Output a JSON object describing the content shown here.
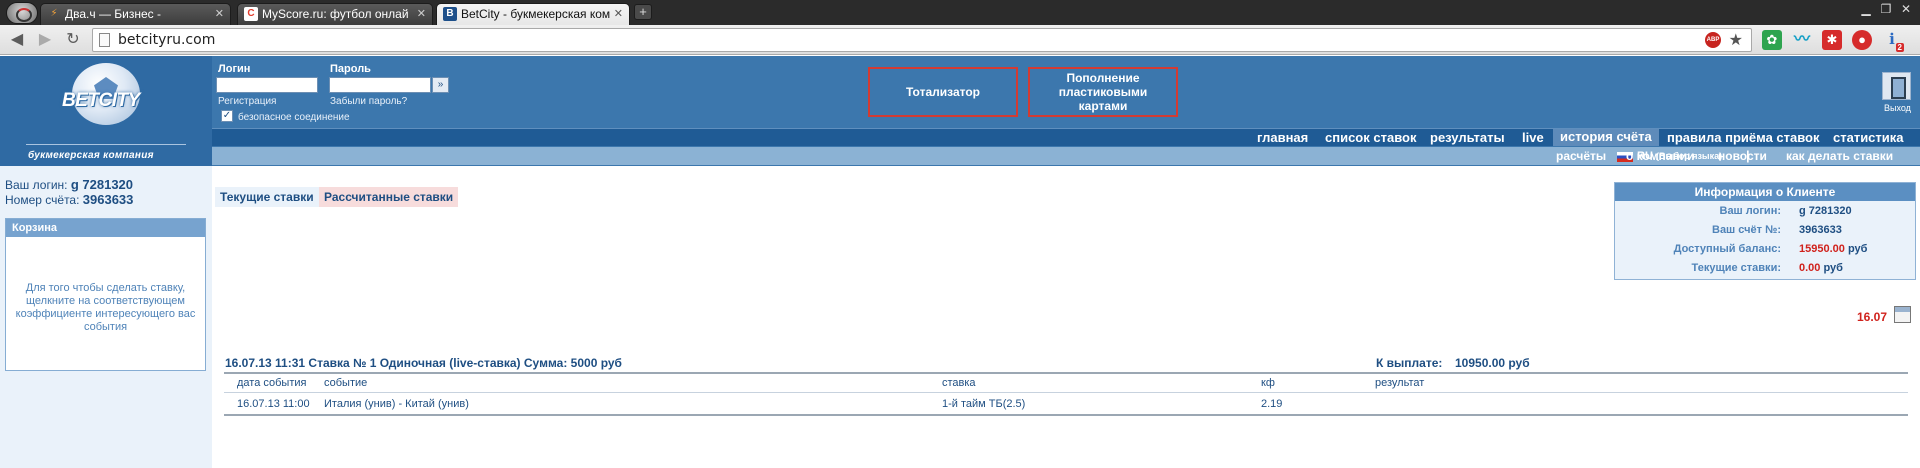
{
  "browser": {
    "tabs": [
      {
        "label": "Два.ч — Бизнес -",
        "icon": "lightning-icon",
        "active": false
      },
      {
        "label": "MyScore.ru: футбол онлай",
        "icon": "myscore-icon",
        "active": false
      },
      {
        "label": "BetCity - букмекерская ком",
        "icon": "betcity-icon",
        "active": true
      }
    ],
    "url": "betcityru.com",
    "adblock_badge": "ABP",
    "extension_badge": "2"
  },
  "header": {
    "logo_text": "BETCITY",
    "logo_subtitle": "букмекерская компания",
    "login_label": "Логин",
    "password_label": "Пароль",
    "register_link": "Регистрация",
    "forgot_link": "Забыли пароль?",
    "secure_label": "безопасное соединение",
    "promo_totalizator": "Тотализатор",
    "promo_topup": "Пополнение пластиковыми картами",
    "exit_label": "Выход"
  },
  "menu_main": [
    "главная",
    "список ставок",
    "результаты",
    "live",
    "история счёта",
    "правила приёма ставок",
    "статистика"
  ],
  "menu_secondary": {
    "lang": "RU",
    "lang_hint": "(Выбор языка)",
    "items": [
      "расчёты",
      "о компании",
      "новости",
      "как делать ставки"
    ]
  },
  "user": {
    "login_label": "Ваш логин:",
    "login_value": "g 7281320",
    "account_label": "Номер счёта:",
    "account_value": "3963633"
  },
  "basket": {
    "title": "Корзина",
    "text": "Для того чтобы сделать ставку, щелкните на соответствующем коэффициенте интересующего вас события"
  },
  "subtabs": [
    "Текущие ставки",
    "Рассчитанные ставки"
  ],
  "client_info": {
    "title": "Информация о Клиенте",
    "rows": [
      {
        "label": "Ваш логин:",
        "value": "g 7281320",
        "unit": ""
      },
      {
        "label": "Ваш счёт №:",
        "value": "3963633",
        "unit": ""
      },
      {
        "label": "Доступный баланс:",
        "value": "15950.00",
        "unit": "руб"
      },
      {
        "label": "Текущие ставки:",
        "value": "0.00",
        "unit": "руб"
      }
    ]
  },
  "date_filter": "16.07",
  "bet": {
    "header": "16.07.13 11:31   Ставка № 1   Одиночная (live-ставка)   Сумма: 5000 руб",
    "payout_label": "К выплате:",
    "payout_value": "10950.00 руб",
    "columns": [
      "дата события",
      "событие",
      "ставка",
      "кф",
      "результат"
    ],
    "row": {
      "date": "16.07.13 11:00",
      "event": "Италия (унив) - Китай (унив)",
      "stake": "1-й тайм ТБ(2.5)",
      "coef": "2.19",
      "result": ""
    }
  }
}
